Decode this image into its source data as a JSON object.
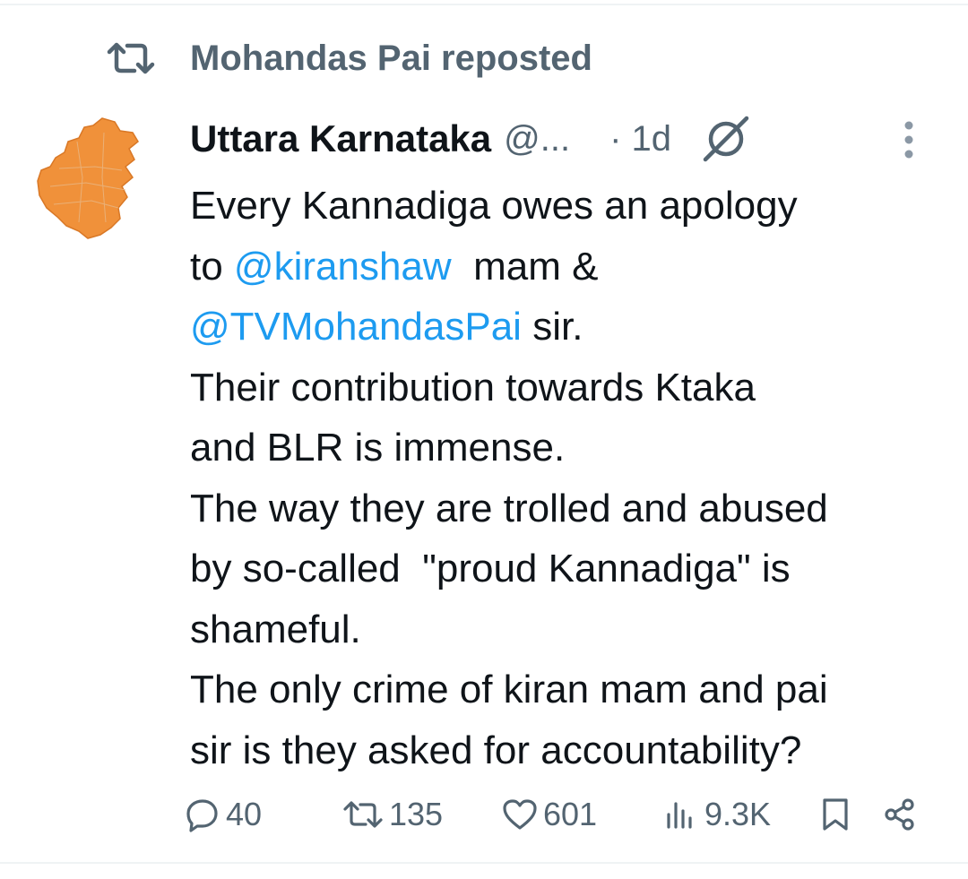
{
  "repost": {
    "text": "Mohandas Pai reposted",
    "icon": "repost-icon"
  },
  "tweet": {
    "author_name": "Uttara Karnataka",
    "author_handle": "@...",
    "time": "· 1d",
    "avatar": "karnataka-map-avatar",
    "grok_icon": "grok-icon",
    "more_icon": "more-options-icon",
    "body": {
      "l1": "Every Kannadiga owes an apology",
      "l2_a": "to ",
      "l2_mention": "@kiranshaw",
      "l2_b": "  mam &",
      "l3_mention": "@TVMohandasPai",
      "l3_b": " sir.",
      "l4": "Their contribution towards Ktaka",
      "l5": "and BLR is immense.",
      "l6": "The way they are trolled and abused",
      "l7": "by so-called  \"proud Kannadiga\" is",
      "l8": "shameful.",
      "l9": "The only crime of kiran mam and pai",
      "l10": "sir is they asked for accountability?"
    }
  },
  "actions": {
    "replies": "40",
    "reposts": "135",
    "likes": "601",
    "views": "9.3K"
  },
  "colors": {
    "text": "#0f1419",
    "secondary": "#536471",
    "mention": "#1d9bf0",
    "avatar_orange": "#f0913a"
  }
}
